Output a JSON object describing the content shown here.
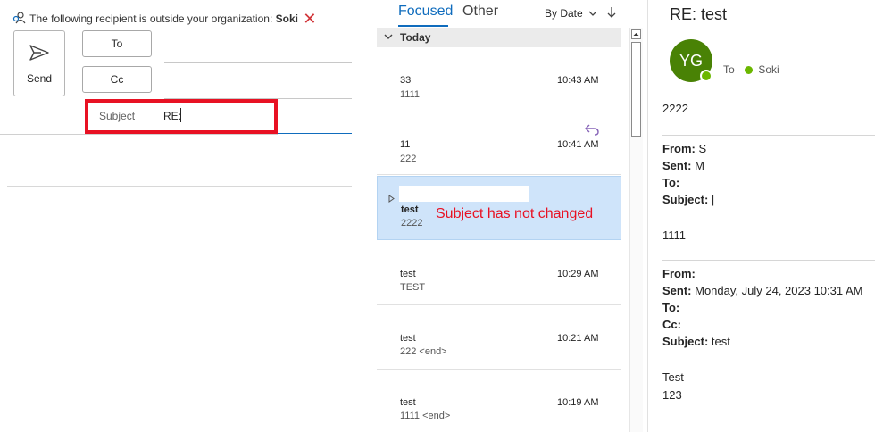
{
  "compose": {
    "warning_text": "The following recipient is outside your organization:",
    "warning_name": "Soki",
    "send_label": "Send",
    "to_label": "To",
    "cc_label": "Cc",
    "subject_label": "Subject",
    "subject_value": "RE:"
  },
  "list": {
    "tab_focused": "Focused",
    "tab_other": "Other",
    "sort_label": "By Date",
    "group_today": "Today",
    "annotation": "Subject has not changed",
    "items": [
      {
        "line1": "33",
        "line2": "1111",
        "time": "10:43 AM"
      },
      {
        "line1": "11",
        "line2": "222",
        "time": "10:41 AM"
      },
      {
        "line1": "test",
        "line2": "2222",
        "time": ""
      },
      {
        "line1": "test",
        "line2": "TEST",
        "time": "10:29 AM"
      },
      {
        "line1": "test",
        "line2": "222 <end>",
        "time": "10:21 AM"
      },
      {
        "line1": "test",
        "line2": "1111 <end>",
        "time": "10:19 AM"
      }
    ]
  },
  "reading": {
    "title": "RE: test",
    "avatar_initials": "YG",
    "to_label": "To",
    "recipient": "Soki",
    "body_top": "2222",
    "quote1": {
      "from_label": "From:",
      "from_value": "S",
      "sent_label": "Sent:",
      "sent_value": "M",
      "to_label": "To:",
      "subject_label": "Subject:",
      "subject_value": "|",
      "body": "1111"
    },
    "quote2": {
      "from_label": "From:",
      "sent_label": "Sent:",
      "sent_value": "Monday, July 24, 2023 10:31 AM",
      "to_label": "To:",
      "cc_label": "Cc:",
      "subject_label": "Subject:",
      "subject_value": "test",
      "body1": "Test",
      "body2": "123"
    }
  },
  "colors": {
    "accent": "#0f6cbd",
    "highlight_red": "#e81123",
    "selected_row": "#cfe4fa",
    "avatar_bg": "#498205"
  }
}
